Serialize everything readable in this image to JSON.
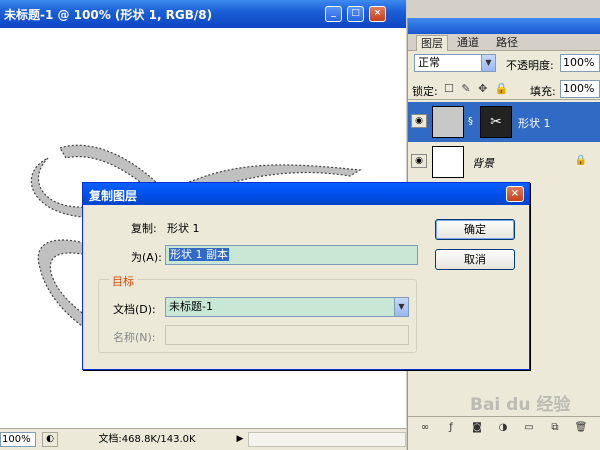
{
  "document": {
    "title": "未标题-1 @ 100% (形状 1, RGB/8)",
    "window_buttons": [
      "_",
      "□",
      "×"
    ],
    "status": {
      "zoom": "100%",
      "nav_icon": "navigate-icon",
      "info": "文档:468.8K/143.0K",
      "arrow": "▶"
    }
  },
  "layers_panel": {
    "tabs": [
      "图层",
      "通道",
      "路径"
    ],
    "blend_mode": "正常",
    "opacity_label": "不透明度:",
    "opacity_value": "100%",
    "lock_label": "锁定:",
    "lock_icons": "☐ ✎ ✥ 🔒",
    "fill_label": "填充:",
    "fill_value": "100%",
    "layers": [
      {
        "name": "形状 1",
        "selected": true,
        "has_mask": true
      },
      {
        "name": "背景",
        "selected": false,
        "locked": true
      }
    ],
    "footer_icons": [
      "link-icon",
      "fx-icon",
      "mask-icon",
      "adjustment-icon",
      "folder-icon",
      "new-layer-icon",
      "trash-icon"
    ]
  },
  "dialog": {
    "title": "复制图层",
    "copy_label": "复制:",
    "copy_value": "形状 1",
    "as_label": "为(A):",
    "as_value": "形状 1 副本",
    "group_title": "目标",
    "doc_label": "文档(D):",
    "doc_value": "未标题-1",
    "name_label": "名称(N):",
    "name_value": "",
    "ok_label": "确定",
    "cancel_label": "取消"
  },
  "watermark": "Bai du 经验",
  "colors": {
    "titlebar": "#1c5fd6",
    "selection": "#316ac5",
    "input_green": "#c9e7d5",
    "group_title": "#d54b0a"
  }
}
